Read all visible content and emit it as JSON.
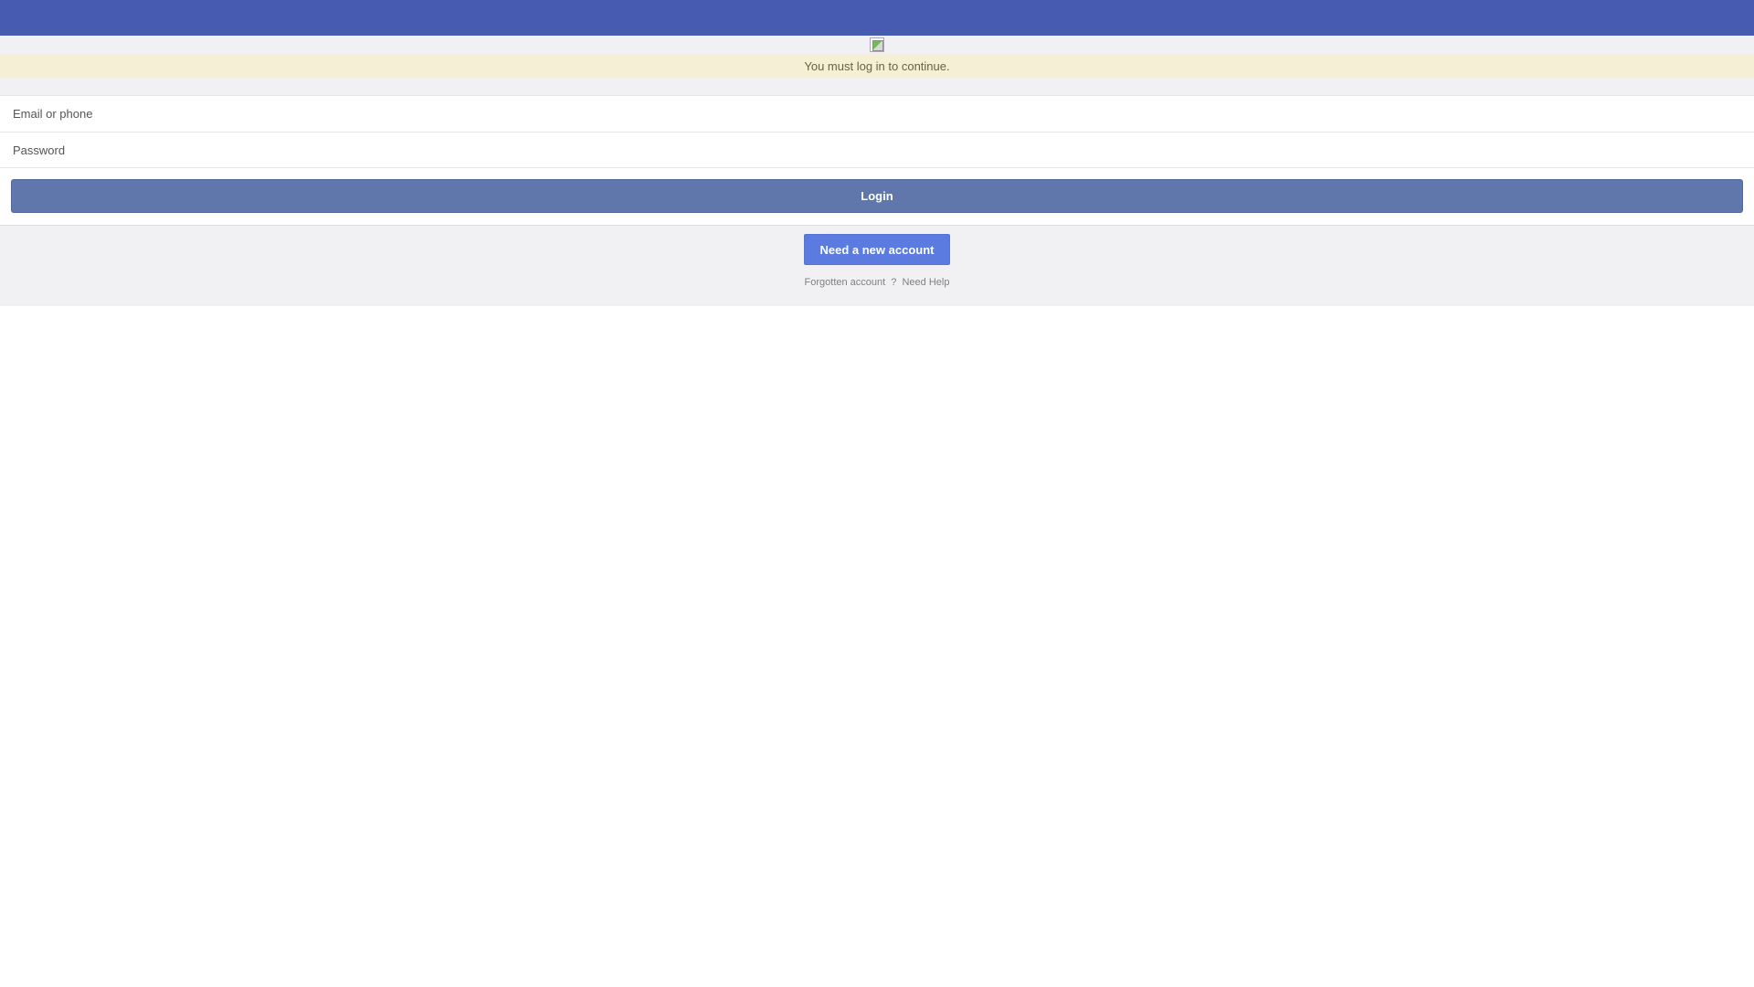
{
  "colors": {
    "topbar": "#475bb1",
    "notice_bg": "#f5f0d5",
    "notice_text": "#6a6040",
    "login_button": "#5f77aa",
    "new_account_button": "#5b7be0"
  },
  "logo": {
    "icon": "broken-image-icon"
  },
  "notice": {
    "text": "You must log in to continue."
  },
  "form": {
    "email_placeholder": "Email or phone",
    "password_placeholder": "Password",
    "login_label": "Login"
  },
  "footer": {
    "new_account_label": "Need a new account",
    "forgotten_label": "Forgotten account",
    "separator": "?",
    "help_label": "Need Help"
  }
}
